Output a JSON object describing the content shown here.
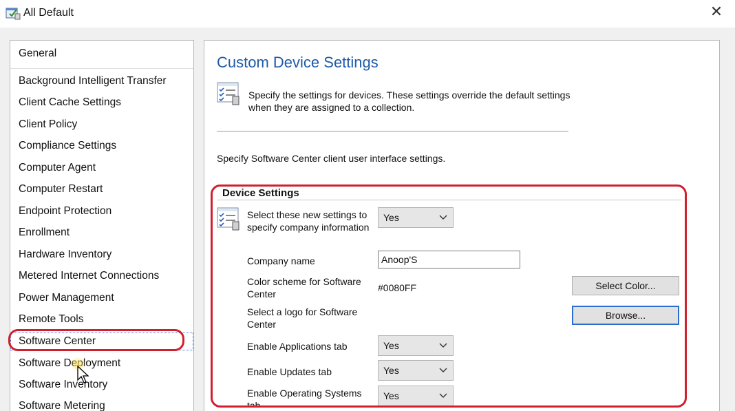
{
  "window": {
    "title": "All Default",
    "close_glyph": "✕",
    "icon": "settings-window-icon"
  },
  "nav": {
    "items": [
      {
        "label": "General"
      },
      {
        "label": "Background Intelligent Transfer"
      },
      {
        "label": "Client Cache Settings"
      },
      {
        "label": "Client Policy"
      },
      {
        "label": "Compliance Settings"
      },
      {
        "label": "Computer Agent"
      },
      {
        "label": "Computer Restart"
      },
      {
        "label": "Endpoint Protection"
      },
      {
        "label": "Enrollment"
      },
      {
        "label": "Hardware Inventory"
      },
      {
        "label": "Metered Internet Connections"
      },
      {
        "label": "Power Management"
      },
      {
        "label": "Remote Tools"
      },
      {
        "label": "Software Center",
        "selected": true
      },
      {
        "label": "Software Deployment"
      },
      {
        "label": "Software Inventory"
      },
      {
        "label": "Software Metering"
      }
    ]
  },
  "main": {
    "title": "Custom Device Settings",
    "description": "Specify the settings for devices. These settings override the default settings when they are assigned to a collection.",
    "intro": "Specify Software Center client user interface settings.",
    "group": {
      "title": "Device Settings",
      "new_settings_label": "Select these new settings to specify company information",
      "new_settings_value": "Yes",
      "company_name_label": "Company name",
      "company_name_value": "Anoop'S",
      "color_scheme_label": "Color scheme for Software Center",
      "color_scheme_value": "#0080FF",
      "select_color_button": "Select Color...",
      "logo_label": "Select a logo for Software Center",
      "browse_button": "Browse...",
      "apps_tab_label": "Enable Applications tab",
      "apps_tab_value": "Yes",
      "updates_tab_label": "Enable Updates tab",
      "updates_tab_value": "Yes",
      "os_tab_label": "Enable Operating Systems tab",
      "os_tab_value": "Yes"
    }
  },
  "colors": {
    "title_blue": "#1e5aa8",
    "annotation_red": "#d0202e",
    "focus_blue": "#2a6fd0"
  }
}
